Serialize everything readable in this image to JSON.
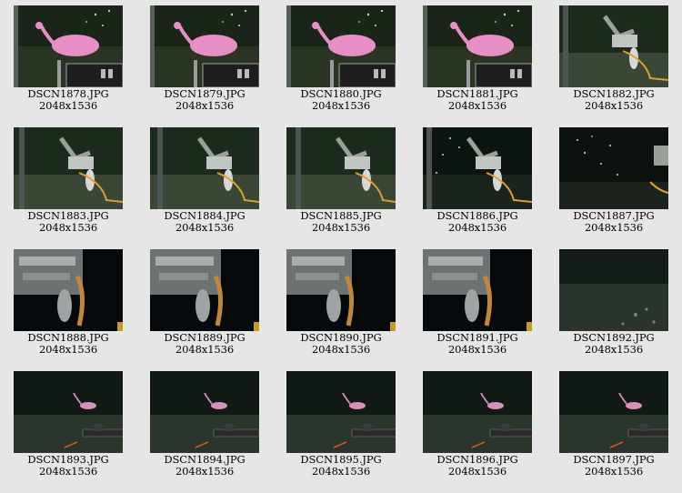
{
  "gallery": {
    "items": [
      {
        "filename": "DSCN1878.JPG",
        "dimensions": "2048x1536",
        "scene": "flamingo-sampler"
      },
      {
        "filename": "DSCN1879.JPG",
        "dimensions": "2048x1536",
        "scene": "flamingo-sampler"
      },
      {
        "filename": "DSCN1880.JPG",
        "dimensions": "2048x1536",
        "scene": "flamingo-sampler"
      },
      {
        "filename": "DSCN1881.JPG",
        "dimensions": "2048x1536",
        "scene": "flamingo-sampler"
      },
      {
        "filename": "DSCN1882.JPG",
        "dimensions": "2048x1536",
        "scene": "robot-arm-seafloor"
      },
      {
        "filename": "DSCN1883.JPG",
        "dimensions": "2048x1536",
        "scene": "robot-arm-seafloor"
      },
      {
        "filename": "DSCN1884.JPG",
        "dimensions": "2048x1536",
        "scene": "robot-arm-seafloor"
      },
      {
        "filename": "DSCN1885.JPG",
        "dimensions": "2048x1536",
        "scene": "robot-arm-seafloor"
      },
      {
        "filename": "DSCN1886.JPG",
        "dimensions": "2048x1536",
        "scene": "robot-arm-bubbles"
      },
      {
        "filename": "DSCN1887.JPG",
        "dimensions": "2048x1536",
        "scene": "bubbles-dark"
      },
      {
        "filename": "DSCN1888.JPG",
        "dimensions": "2048x1536",
        "scene": "claw-closeup"
      },
      {
        "filename": "DSCN1889.JPG",
        "dimensions": "2048x1536",
        "scene": "claw-closeup"
      },
      {
        "filename": "DSCN1890.JPG",
        "dimensions": "2048x1536",
        "scene": "claw-closeup"
      },
      {
        "filename": "DSCN1891.JPG",
        "dimensions": "2048x1536",
        "scene": "claw-closeup"
      },
      {
        "filename": "DSCN1892.JPG",
        "dimensions": "2048x1536",
        "scene": "seafloor-murky"
      },
      {
        "filename": "DSCN1893.JPG",
        "dimensions": "2048x1536",
        "scene": "flamingo-distant"
      },
      {
        "filename": "DSCN1894.JPG",
        "dimensions": "2048x1536",
        "scene": "flamingo-distant"
      },
      {
        "filename": "DSCN1895.JPG",
        "dimensions": "2048x1536",
        "scene": "flamingo-distant"
      },
      {
        "filename": "DSCN1896.JPG",
        "dimensions": "2048x1536",
        "scene": "flamingo-distant"
      },
      {
        "filename": "DSCN1897.JPG",
        "dimensions": "2048x1536",
        "scene": "flamingo-distant"
      }
    ]
  }
}
